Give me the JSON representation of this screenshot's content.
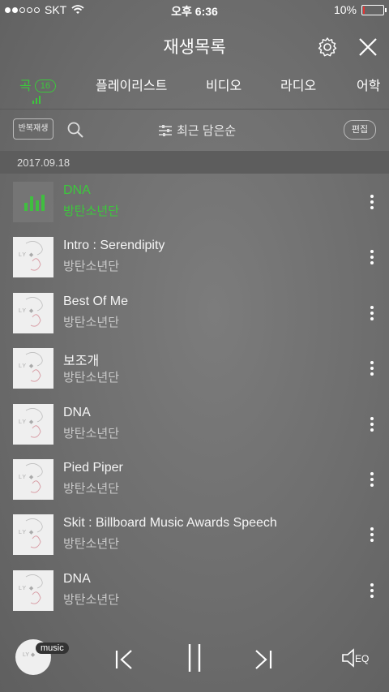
{
  "status_bar": {
    "carrier": "SKT",
    "time": "오후 6:36",
    "battery": "10%",
    "battery_level": 0.1,
    "battery_color": "#e33333"
  },
  "header": {
    "title": "재생목록"
  },
  "tabs": [
    {
      "label": "곡",
      "badge": "16",
      "active": true
    },
    {
      "label": "플레이리스트"
    },
    {
      "label": "비디오"
    },
    {
      "label": "라디오"
    },
    {
      "label": "어학"
    }
  ],
  "toolbar": {
    "repeat_label": "반복재생",
    "sort_label": "최근 담은순",
    "edit_label": "편집"
  },
  "date_header": "2017.09.18",
  "songs": [
    {
      "title": "DNA",
      "artist": "방탄소년단",
      "playing": true
    },
    {
      "title": "Intro : Serendipity",
      "artist": "방탄소년단"
    },
    {
      "title": "Best Of Me",
      "artist": "방탄소년단"
    },
    {
      "title": "보조개",
      "artist": "방탄소년단"
    },
    {
      "title": "DNA",
      "artist": "방탄소년단"
    },
    {
      "title": "Pied Piper",
      "artist": "방탄소년단"
    },
    {
      "title": "Skit : Billboard Music Awards Speech",
      "artist": "방탄소년단"
    },
    {
      "title": "DNA",
      "artist": "방탄소년단"
    }
  ],
  "player": {
    "badge": "music",
    "eq_label": "EQ"
  },
  "colors": {
    "accent": "#3cc83c"
  }
}
